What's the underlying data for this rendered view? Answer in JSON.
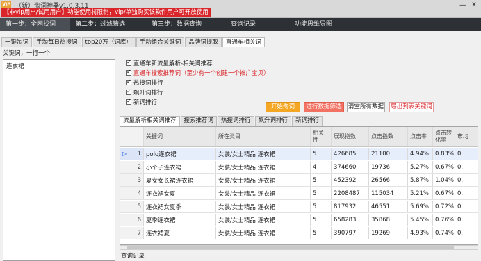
{
  "titlebar": {
    "vip_badge": "VIP",
    "app_title": "（新）淘词神器v1.0.3.11",
    "warning": "【非vip用户/试用用户】功能使用将限制，vip/单独购买该软件用户可开放使用",
    "minimize": "—",
    "close": "✕"
  },
  "topnav": [
    {
      "label": "第一步：全网找词",
      "active": true
    },
    {
      "label": "第二步：过滤筛选",
      "active": false
    },
    {
      "label": "第三步：数据查询",
      "active": false
    },
    {
      "label": "查询记录",
      "active": false
    },
    {
      "label": "功能思维导图",
      "active": false
    }
  ],
  "subtabs": [
    {
      "label": "一键淘词",
      "active": false
    },
    {
      "label": "手淘每日热搜词",
      "active": false
    },
    {
      "label": "top20万（词库）",
      "active": false
    },
    {
      "label": "手动组合关键词",
      "active": false
    },
    {
      "label": "品牌词提取",
      "active": false
    },
    {
      "label": "直通车相关词",
      "active": true
    }
  ],
  "left_panel": {
    "label": "关键词，一行一个",
    "content": "连衣裙"
  },
  "options": [
    {
      "label": "直通车新流量解析-相关词推荐",
      "checked": true,
      "red": false
    },
    {
      "label": "直通车搜索推荐词（至少有一个创建一个推广宝贝）",
      "checked": true,
      "red": true
    },
    {
      "label": "热搜词排行",
      "checked": true,
      "red": false
    },
    {
      "label": "飙升词排行",
      "checked": true,
      "red": false
    },
    {
      "label": "新词排行",
      "checked": true,
      "red": false
    }
  ],
  "buttons": {
    "start": "开始淘词",
    "filter": "进行数据筛选",
    "clear": "清空所有数据",
    "export": "导出列表关键词"
  },
  "result_tabs": [
    {
      "label": "流量解析相关词推荐",
      "active": true
    },
    {
      "label": "搜索推荐词",
      "active": false
    },
    {
      "label": "热搜词排行",
      "active": false
    },
    {
      "label": "飙升词排行",
      "active": false
    },
    {
      "label": "新词排行",
      "active": false
    }
  ],
  "grid": {
    "headers": [
      "关键词",
      "所在类目",
      "相关性",
      "展现指数",
      "点击指数",
      "点击率",
      "点击转化率",
      "市均"
    ],
    "rows": [
      {
        "num": "1",
        "keyword": "polo连衣裙",
        "category": "女装/女士精品 连衣裙",
        "relevance": "5",
        "impressions": "426685",
        "clicks": "21100",
        "ctr": "4.94%",
        "cvr": "0.83%",
        "extra": "0."
      },
      {
        "num": "2",
        "keyword": "小个子连衣裙",
        "category": "女装/女士精品 连衣裙",
        "relevance": "4",
        "impressions": "374660",
        "clicks": "19736",
        "ctr": "5.27%",
        "cvr": "0.67%",
        "extra": "0."
      },
      {
        "num": "3",
        "keyword": "夏女女长裙连衣裙",
        "category": "女装/女士精品 连衣裙",
        "relevance": "5",
        "impressions": "452392",
        "clicks": "26566",
        "ctr": "5.87%",
        "cvr": "1.04%",
        "extra": "0."
      },
      {
        "num": "4",
        "keyword": "连衣裙女夏",
        "category": "女装/女士精品 连衣裙",
        "relevance": "5",
        "impressions": "2208487",
        "clicks": "115034",
        "ctr": "5.21%",
        "cvr": "0.67%",
        "extra": "0."
      },
      {
        "num": "5",
        "keyword": "连衣裙女夏季",
        "category": "女装/女士精品 连衣裙",
        "relevance": "5",
        "impressions": "817932",
        "clicks": "46551",
        "ctr": "5.69%",
        "cvr": "0.72%",
        "extra": "0."
      },
      {
        "num": "6",
        "keyword": "夏季连衣裙",
        "category": "女装/女士精品 连衣裙",
        "relevance": "5",
        "impressions": "658283",
        "clicks": "35868",
        "ctr": "5.45%",
        "cvr": "0.76%",
        "extra": "0."
      },
      {
        "num": "7",
        "keyword": "连衣裙夏",
        "category": "女装/女士精品 连衣裙",
        "relevance": "5",
        "impressions": "390797",
        "clicks": "19269",
        "ctr": "4.93%",
        "cvr": "0.74%",
        "extra": "0."
      }
    ]
  },
  "log_label": "查询记录",
  "colors": {
    "topnav_bg": "#2d3136",
    "warning_bg": "#d9262b",
    "start_button": "#f5a623",
    "filter_button": "#f37263",
    "accent_red": "#d9262b"
  }
}
